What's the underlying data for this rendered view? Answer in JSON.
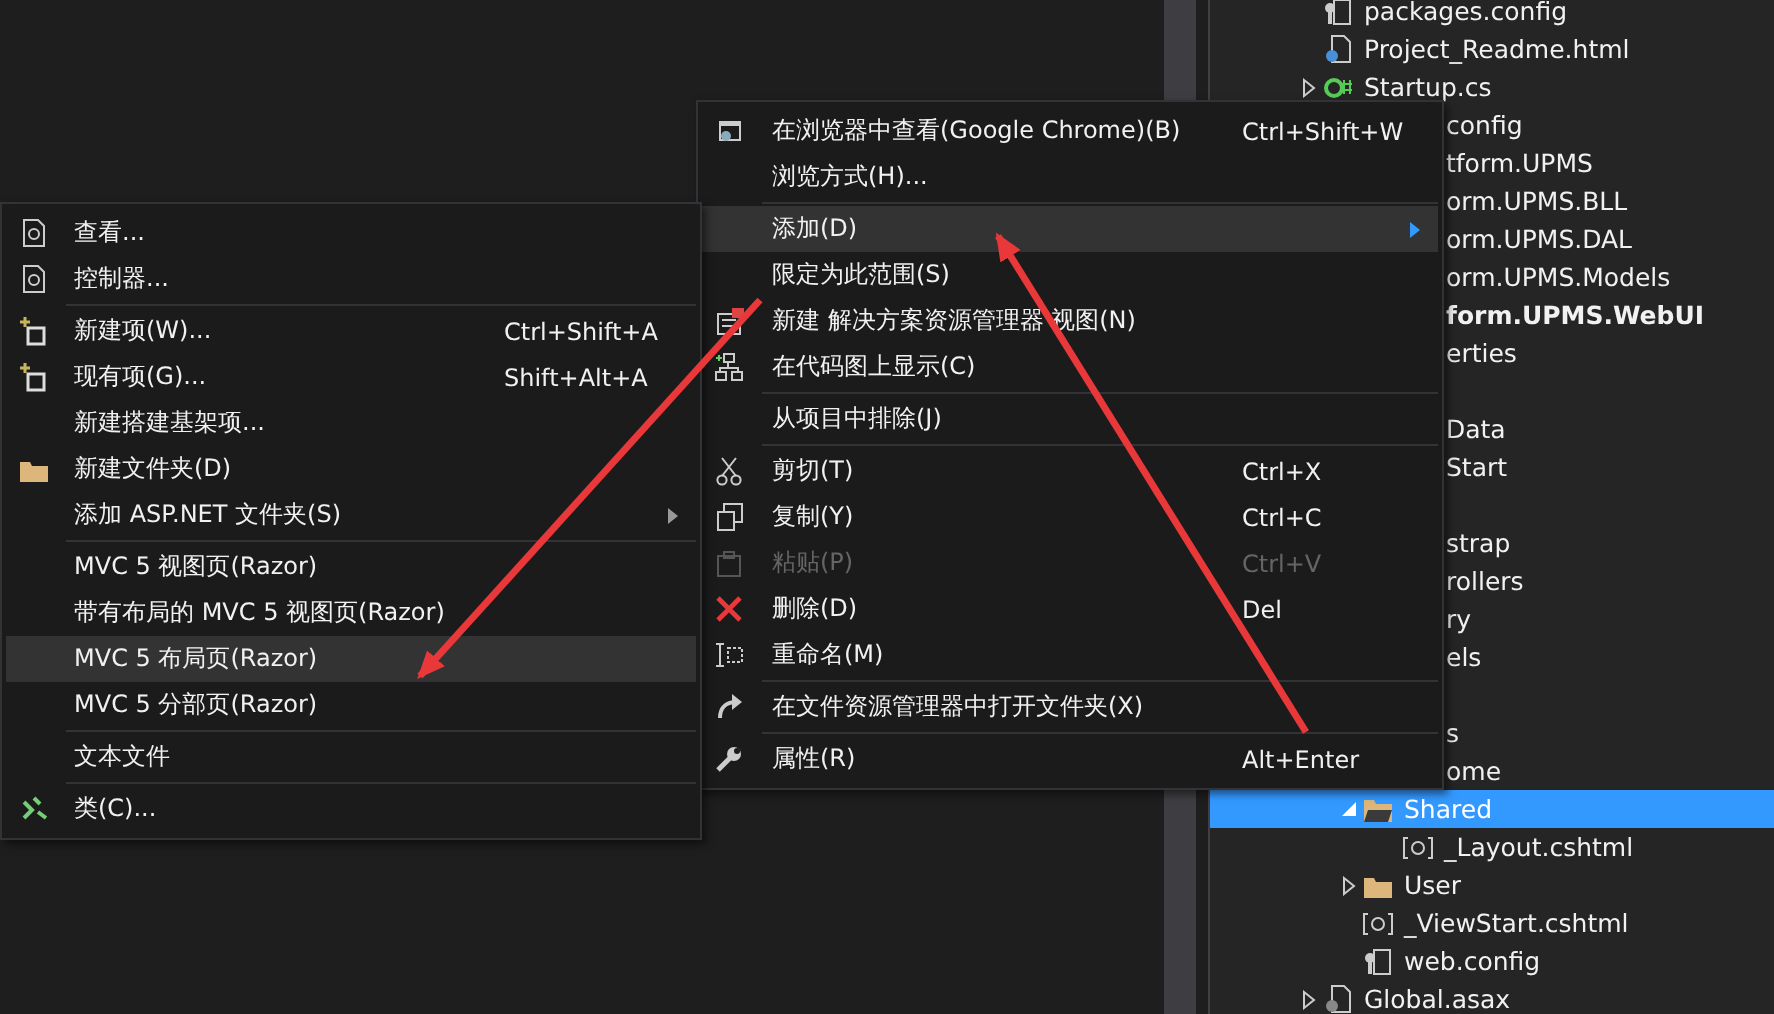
{
  "context_menu": {
    "items": [
      {
        "kind": "item",
        "label": "在浏览器中查看(Google Chrome)(B)",
        "shortcut": "Ctrl+Shift+W",
        "selected": false,
        "disabled": false,
        "submenu": false
      },
      {
        "kind": "item",
        "label": "浏览方式(H)...",
        "selected": false,
        "disabled": false,
        "submenu": false
      },
      {
        "kind": "separator"
      },
      {
        "kind": "item",
        "label": "添加(D)",
        "selected": true,
        "disabled": false,
        "submenu": true
      },
      {
        "kind": "item",
        "label": "限定为此范围(S)",
        "selected": false,
        "disabled": false,
        "submenu": false
      },
      {
        "kind": "item",
        "label": "新建 解决方案资源管理器 视图(N)",
        "selected": false,
        "disabled": false,
        "submenu": false
      },
      {
        "kind": "item",
        "label": "在代码图上显示(C)",
        "selected": false,
        "disabled": false,
        "submenu": false
      },
      {
        "kind": "separator"
      },
      {
        "kind": "item",
        "label": "从项目中排除(J)",
        "selected": false,
        "disabled": false,
        "submenu": false
      },
      {
        "kind": "separator"
      },
      {
        "kind": "item",
        "label": "剪切(T)",
        "shortcut": "Ctrl+X",
        "selected": false,
        "disabled": false,
        "submenu": false
      },
      {
        "kind": "item",
        "label": "复制(Y)",
        "shortcut": "Ctrl+C",
        "selected": false,
        "disabled": false,
        "submenu": false
      },
      {
        "kind": "item",
        "label": "粘贴(P)",
        "shortcut": "Ctrl+V",
        "selected": false,
        "disabled": true,
        "submenu": false
      },
      {
        "kind": "item",
        "label": "删除(D)",
        "shortcut": "Del",
        "selected": false,
        "disabled": false,
        "submenu": false
      },
      {
        "kind": "item",
        "label": "重命名(M)",
        "selected": false,
        "disabled": false,
        "submenu": false
      },
      {
        "kind": "separator"
      },
      {
        "kind": "item",
        "label": "在文件资源管理器中打开文件夹(X)",
        "selected": false,
        "disabled": false,
        "submenu": false
      },
      {
        "kind": "separator"
      },
      {
        "kind": "item",
        "label": "属性(R)",
        "shortcut": "Alt+Enter",
        "selected": false,
        "disabled": false,
        "submenu": false
      }
    ]
  },
  "add_submenu": {
    "items": [
      {
        "kind": "item",
        "label": "查看...",
        "selected": false,
        "disabled": false,
        "submenu": false
      },
      {
        "kind": "item",
        "label": "控制器...",
        "selected": false,
        "disabled": false,
        "submenu": false
      },
      {
        "kind": "separator"
      },
      {
        "kind": "item",
        "label": "新建项(W)...",
        "shortcut": "Ctrl+Shift+A",
        "selected": false,
        "disabled": false,
        "submenu": false
      },
      {
        "kind": "item",
        "label": "现有项(G)...",
        "shortcut": "Shift+Alt+A",
        "selected": false,
        "disabled": false,
        "submenu": false
      },
      {
        "kind": "item",
        "label": "新建搭建基架项...",
        "selected": false,
        "disabled": false,
        "submenu": false
      },
      {
        "kind": "item",
        "label": "新建文件夹(D)",
        "selected": false,
        "disabled": false,
        "submenu": false
      },
      {
        "kind": "item",
        "label": "添加 ASP.NET 文件夹(S)",
        "selected": false,
        "disabled": false,
        "submenu": true
      },
      {
        "kind": "separator"
      },
      {
        "kind": "item",
        "label": "MVC 5 视图页(Razor)",
        "selected": false,
        "disabled": false,
        "submenu": false
      },
      {
        "kind": "item",
        "label": "带有布局的 MVC 5 视图页(Razor)",
        "selected": false,
        "disabled": false,
        "submenu": false
      },
      {
        "kind": "item",
        "label": "MVC 5 布局页(Razor)",
        "selected": true,
        "disabled": false,
        "submenu": false
      },
      {
        "kind": "item",
        "label": "MVC 5 分部页(Razor)",
        "selected": false,
        "disabled": false,
        "submenu": false
      },
      {
        "kind": "separator"
      },
      {
        "kind": "item",
        "label": "文本文件",
        "selected": false,
        "disabled": false,
        "submenu": false
      },
      {
        "kind": "separator"
      },
      {
        "kind": "item",
        "label": "类(C)...",
        "selected": false,
        "disabled": false,
        "submenu": false
      }
    ]
  },
  "solution_explorer": {
    "items": [
      {
        "kind": "config",
        "label": "packages.config",
        "selected": false,
        "bold": false
      },
      {
        "kind": "html",
        "label": "Project_Readme.html",
        "selected": false,
        "bold": false
      },
      {
        "kind": "csharp",
        "label": "Startup.cs",
        "expanded": false,
        "selected": false,
        "bold": false
      },
      {
        "kind": "config",
        "label": "config",
        "selected": false,
        "bold": false
      },
      {
        "kind": "project",
        "label": "tform.UPMS",
        "selected": false,
        "bold": false
      },
      {
        "kind": "project",
        "label": "orm.UPMS.BLL",
        "selected": false,
        "bold": false
      },
      {
        "kind": "project",
        "label": "orm.UPMS.DAL",
        "selected": false,
        "bold": false
      },
      {
        "kind": "project",
        "label": "orm.UPMS.Models",
        "selected": false,
        "bold": false
      },
      {
        "kind": "project",
        "label": "form.UPMS.WebUI",
        "selected": false,
        "bold": true
      },
      {
        "kind": "folder",
        "label": "erties",
        "selected": false,
        "bold": false
      },
      {
        "kind": "covered"
      },
      {
        "kind": "folder",
        "label": "Data",
        "selected": false,
        "bold": false
      },
      {
        "kind": "folder",
        "label": "Start",
        "selected": false,
        "bold": false
      },
      {
        "kind": "covered"
      },
      {
        "kind": "folder",
        "label": "strap",
        "selected": false,
        "bold": false
      },
      {
        "kind": "folder",
        "label": "rollers",
        "selected": false,
        "bold": false
      },
      {
        "kind": "folder",
        "label": "ry",
        "selected": false,
        "bold": false
      },
      {
        "kind": "folder",
        "label": "els",
        "selected": false,
        "bold": false
      },
      {
        "kind": "covered"
      },
      {
        "kind": "folder",
        "label": "s",
        "selected": false,
        "bold": false,
        "children": [
          {
            "kind": "folder",
            "label": "ome",
            "selected": false,
            "bold": false
          },
          {
            "kind": "folder",
            "label": "Shared",
            "expanded": true,
            "selected": true,
            "bold": false,
            "children": [
              {
                "kind": "razor",
                "label": "_Layout.cshtml",
                "selected": false,
                "bold": false
              }
            ]
          },
          {
            "kind": "folder",
            "label": "User",
            "expanded": false,
            "selected": false,
            "bold": false
          },
          {
            "kind": "razor",
            "label": "_ViewStart.cshtml",
            "selected": false,
            "bold": false
          },
          {
            "kind": "config",
            "label": "web.config",
            "selected": false,
            "bold": false
          }
        ]
      },
      {
        "kind": "asax",
        "label": "Global.asax",
        "expanded": false,
        "selected": false,
        "bold": false
      }
    ]
  }
}
